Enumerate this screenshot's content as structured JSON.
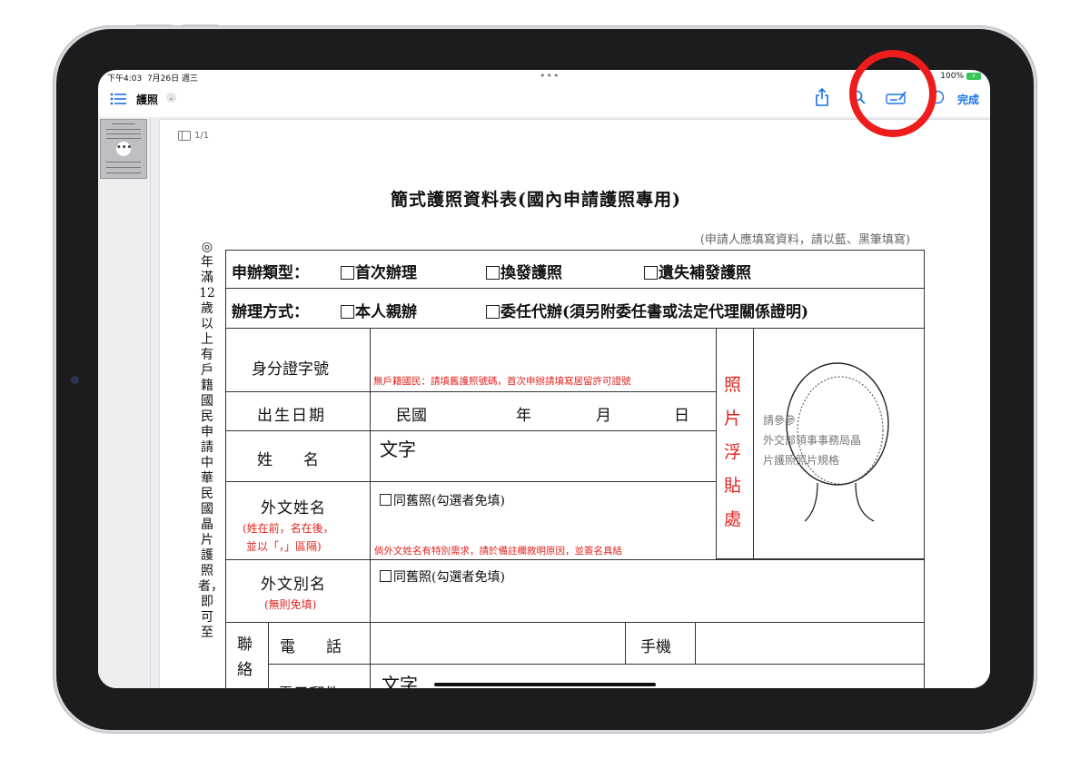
{
  "status_bar": {
    "time": "下午4:03",
    "date": "7月26日 週三",
    "battery": "100%"
  },
  "toolbar": {
    "doc_title": "護照",
    "done_label": "完成"
  },
  "viewer": {
    "page_indicator": "1/1"
  },
  "form": {
    "title": "簡式護照資料表(國內申請護照專用)",
    "note": "(申請人應填寫資料，請以藍、黑筆填寫)",
    "side_note": "◎年滿12歲以上有戶籍國民申請中華民國晶片護照者，即可至",
    "row1": {
      "label": "申辦類型：",
      "opt1": "首次辦理",
      "opt2": "換發護照",
      "opt3": "遺失補發護照"
    },
    "row2": {
      "label": "辦理方式：",
      "opt1": "本人親辦",
      "opt2": "委任代辦(須另附委任書或法定代理關係證明)"
    },
    "id_label": "身分證字號",
    "id_hint": "無戶籍國民：請填舊護照號碼，首次申辦請填寫居留許可證號",
    "birth_label": "出生日期",
    "birth_era": "民國",
    "birth_year": "年",
    "birth_month": "月",
    "birth_day": "日",
    "name_label": "姓　　名",
    "name_value": "文字",
    "foreign_name_label": "外文姓名",
    "foreign_name_note1": "(姓在前，名在後，",
    "foreign_name_note2": "並以「，」區隔)",
    "same_as_old": "同舊照(勾選者免填)",
    "foreign_name_hint": "倘外文姓名有特別需求，請於備註欄敘明原因，並簽名具結",
    "photo_label": "照片浮貼處",
    "photo_text1": "請參參",
    "photo_text2": "外交部領事事務局晶",
    "photo_text3": "片護照照片規格",
    "alias_label": "外文別名",
    "alias_note": "(無則免填)",
    "alias_same": "同舊照(勾選者免填)",
    "contact_label": "聯絡",
    "phone_label": "電　　話",
    "mobile_label": "手機",
    "email_label": "電子郵件",
    "email_value": "文字"
  }
}
